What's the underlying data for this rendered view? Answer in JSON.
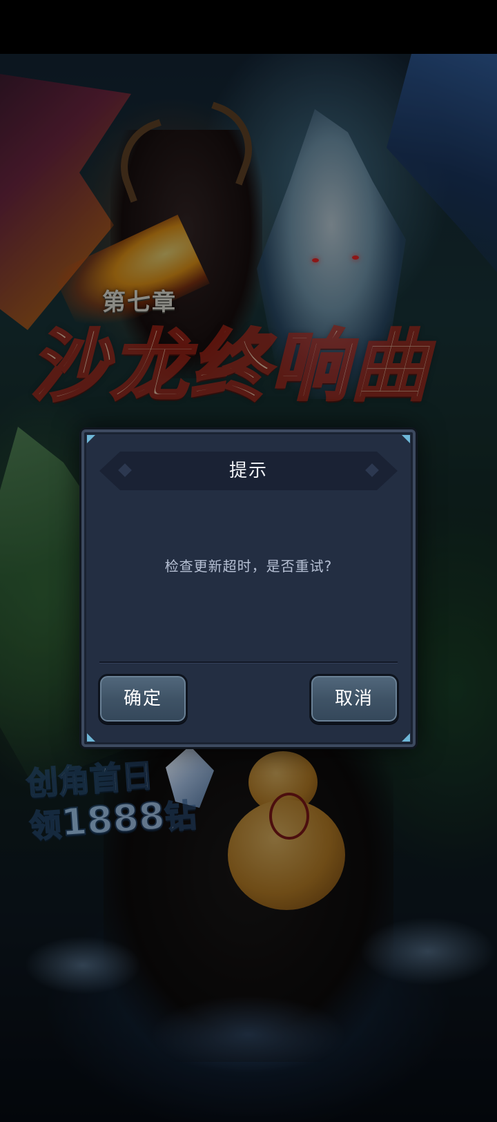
{
  "background": {
    "chapter_label": "第七章",
    "chapter_title": "沙龙终响曲",
    "promo": {
      "line1": "创角首日",
      "line2_prefix": "领",
      "line2_number": "1888",
      "line2_suffix": "钻"
    }
  },
  "dialog": {
    "title": "提示",
    "message": "检查更新超时，是否重试?",
    "confirm_label": "确定",
    "cancel_label": "取消"
  },
  "colors": {
    "dialog_bg": "#232e42",
    "button_bg": "#3f5366",
    "accent_corner": "#6fb8d8"
  }
}
